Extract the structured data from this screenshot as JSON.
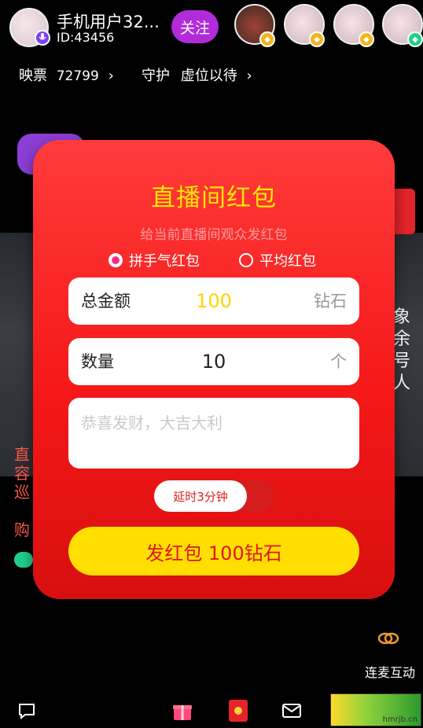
{
  "host": {
    "name": "手机用户32...",
    "id": "ID:43456",
    "follow_label": "关注"
  },
  "stats": {
    "tickets_label": "映票",
    "tickets_value": "72799",
    "guard_label": "守护",
    "guard_value": "虚位以待"
  },
  "side_text": "象余号人",
  "left_text": "直容巡",
  "left_buy": "购",
  "modal": {
    "title": "直播间红包",
    "subtitle": "给当前直播间观众发红包",
    "radio_lucky": "拼手气红包",
    "radio_even": "平均红包",
    "amount_label": "总金额",
    "amount_value": "100",
    "amount_unit": "钻石",
    "count_label": "数量",
    "count_value": "10",
    "count_unit": "个",
    "message_placeholder": "恭喜发财，大吉大利",
    "delay_label": "延时3分钟",
    "send_label": "发红包 100钻石"
  },
  "lianmai": {
    "label": "连麦互动"
  },
  "watermark": {
    "site": "hmrjb.cn"
  },
  "colors": {
    "modal_red": "#f51818",
    "title_yellow": "#ffe500",
    "send_yellow": "#ffde00",
    "follow_purple": "#b12bd9"
  },
  "icons": [
    "mic-icon",
    "chevron-right-icon",
    "chat-icon",
    "gift-icon",
    "red-packet-icon",
    "mail-icon",
    "link-icon"
  ]
}
